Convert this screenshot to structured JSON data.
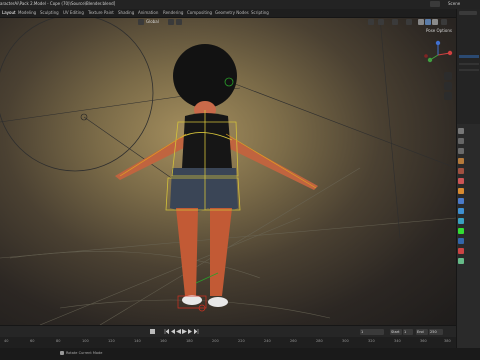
{
  "window": {
    "title": "aracterAi\\Pack 2.Model - Cope (70)\\Source\\Blender.blend]"
  },
  "workspace_tabs": [
    {
      "label": "Layout",
      "active": true
    },
    {
      "label": "Modeling"
    },
    {
      "label": "Sculpting"
    },
    {
      "label": "UV Editing"
    },
    {
      "label": "Texture Paint"
    },
    {
      "label": "Shading"
    },
    {
      "label": "Animation"
    },
    {
      "label": "Rendering"
    },
    {
      "label": "Compositing"
    },
    {
      "label": "Geometry Nodes"
    },
    {
      "label": "Scripting"
    }
  ],
  "top_right": {
    "scene_label": "Scene"
  },
  "viewport": {
    "mode_label": "Global",
    "pose_options": "Pose Options",
    "accent_color": "#e0a020",
    "bone_color": "#d4c23a",
    "ik_color": "#2aa02a"
  },
  "timeline": {
    "current_frame": "1",
    "start_label": "Start",
    "start_value": "1",
    "end_label": "End",
    "end_value": "250",
    "ruler_ticks": [
      "40",
      "60",
      "80",
      "100",
      "120",
      "140",
      "160",
      "180",
      "200",
      "220",
      "240",
      "260",
      "280",
      "300",
      "320",
      "340",
      "360",
      "380"
    ]
  },
  "status": {
    "text": "Rotate Current Mode"
  },
  "icons": {
    "play": "play-icon",
    "jump_start": "jump-start-icon",
    "jump_end": "jump-end-icon",
    "step_back": "step-back-icon",
    "step_forward": "step-forward-icon"
  }
}
